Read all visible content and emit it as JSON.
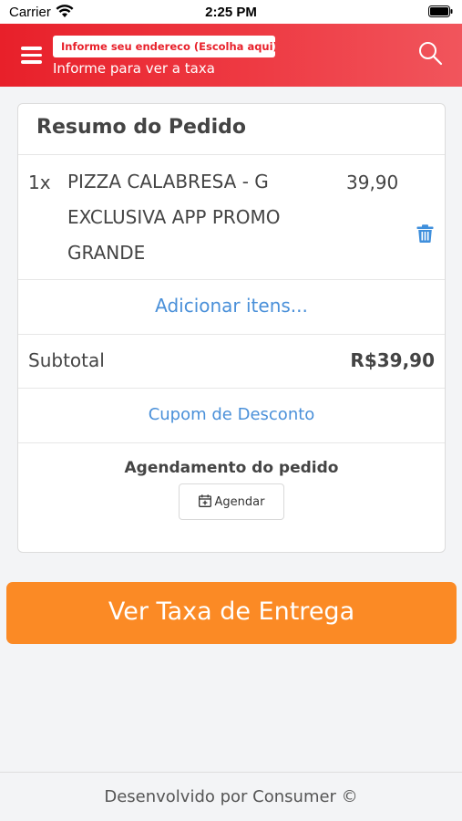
{
  "status_bar": {
    "carrier": "Carrier",
    "time": "2:25 PM"
  },
  "header": {
    "address_select": "Informe seu endereco (Escolha aqui)",
    "address_sub": "Informe para ver a taxa",
    "menu_icon": "hamburger-menu-icon",
    "search_icon": "search-icon"
  },
  "order": {
    "title": "Resumo do Pedido",
    "items": [
      {
        "qty": "1x",
        "name": "PIZZA CALABRESA - G EXCLUSIVA APP PROMO GRANDE",
        "price": "39,90"
      }
    ],
    "add_items": "Adicionar itens...",
    "subtotal_label": "Subtotal",
    "subtotal_value": "R$39,90",
    "coupon": "Cupom de Desconto",
    "schedule_title": "Agendamento do pedido",
    "schedule_button": "Agendar"
  },
  "cta": {
    "label": "Ver Taxa de Entrega"
  },
  "footer": {
    "text": "Desenvolvido por Consumer ©"
  },
  "colors": {
    "header_red": "#e8202a",
    "link_blue": "#4a90d9",
    "cta_orange": "#fb8a25"
  }
}
